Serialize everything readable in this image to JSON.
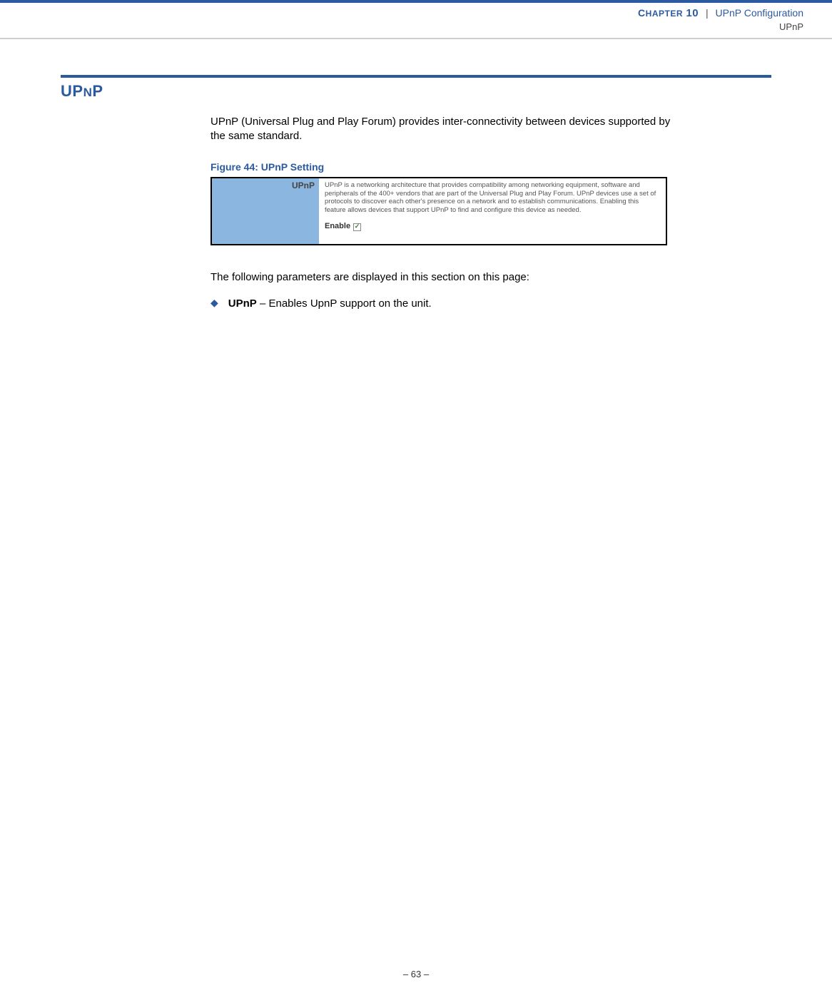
{
  "header": {
    "chapter_label_prefix": "C",
    "chapter_label_rest": "HAPTER",
    "chapter_number": "10",
    "separator": "|",
    "chapter_title": "UPnP Configuration",
    "subtitle": "UPnP"
  },
  "section": {
    "title_part1": "UP",
    "title_part2": "N",
    "title_part3": "P"
  },
  "content": {
    "intro": "UPnP (Universal Plug and Play Forum) provides inter-connectivity between devices supported by the same standard.",
    "figure_caption": "Figure 44:  UPnP Setting",
    "figure_sidebar_label": "UPnP",
    "figure_description": "UPnP is a networking architecture that provides compatibility among networking equipment, software and peripherals of the 400+ vendors that are part of the Universal Plug and Play Forum. UPnP devices use a set of protocols to discover each other's presence on a network and to establish communications. Enabling this feature allows devices that support UPnP to find and configure this device as needed.",
    "figure_enable_label": "Enable",
    "params_intro": "The following parameters are displayed in this section on this page:",
    "bullet_label": "UPnP",
    "bullet_text": " – Enables UpnP support on the unit."
  },
  "footer": {
    "page_number": "–  63  –"
  }
}
